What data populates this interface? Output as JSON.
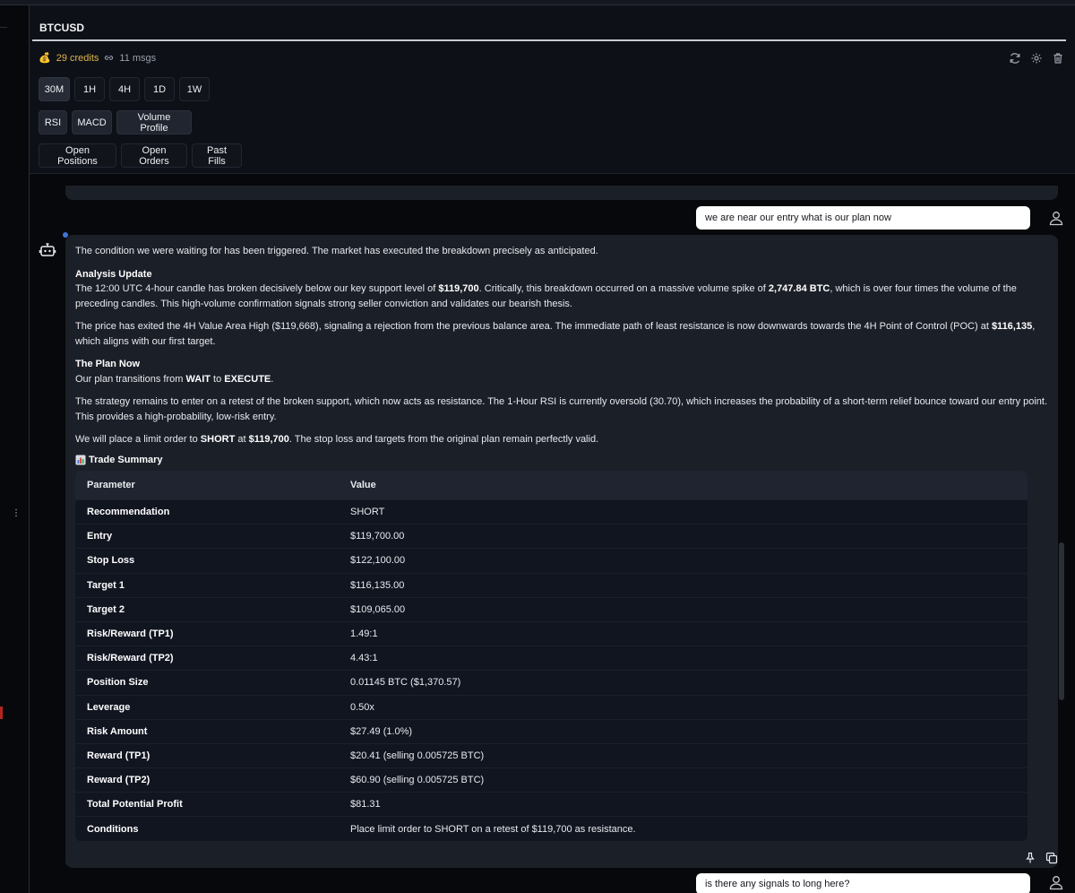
{
  "header": {
    "title": "BTCUSD",
    "credits": "29 credits",
    "msgs": "11 msgs",
    "icons": [
      "refresh-icon",
      "settings-icon",
      "trash-icon"
    ]
  },
  "timeframes": [
    "30M",
    "1H",
    "4H",
    "1D",
    "1W"
  ],
  "active_timeframe": "30M",
  "indicators": [
    "RSI",
    "MACD",
    "Volume Profile"
  ],
  "data_tabs": [
    "Open Positions",
    "Open Orders",
    "Past Fills"
  ],
  "chat": {
    "user_msg_1": "we are near our entry what is our plan now",
    "user_msg_2": "is there any signals to long here?",
    "bot": {
      "intro": "The condition we were waiting for has been triggered. The market has executed the breakdown precisely as anticipated.",
      "analysis_heading": "Analysis Update",
      "analysis_p1_a": "The 12:00 UTC 4-hour candle has broken decisively below our key support level of ",
      "analysis_p1_b": "$119,700",
      "analysis_p1_c": ". Critically, this breakdown occurred on a massive volume spike of ",
      "analysis_p1_d": "2,747.84 BTC",
      "analysis_p1_e": ", which is over four times the volume of the preceding candles. This high-volume confirmation signals strong seller conviction and validates our bearish thesis.",
      "analysis_p2_a": "The price has exited the 4H Value Area High ($119,668), signaling a rejection from the previous balance area. The immediate path of least resistance is now downwards towards the 4H Point of Control (POC) at ",
      "analysis_p2_b": "$116,135",
      "analysis_p2_c": ", which aligns with our first target.",
      "plan_heading": "The Plan Now",
      "plan_p1_a": "Our plan transitions from ",
      "plan_p1_b": "WAIT",
      "plan_p1_c": " to ",
      "plan_p1_d": "EXECUTE",
      "plan_p1_e": ".",
      "plan_p2": "The strategy remains to enter on a retest of the broken support, which now acts as resistance. The 1-Hour RSI is currently oversold (30.70), which increases the probability of a short-term relief bounce toward our entry point. This provides a high-probability, low-risk entry.",
      "plan_p3_a": "We will place a limit order to ",
      "plan_p3_b": "SHORT",
      "plan_p3_c": " at ",
      "plan_p3_d": "$119,700",
      "plan_p3_e": ". The stop loss and targets from the original plan remain perfectly valid.",
      "summary_heading": "Trade Summary",
      "table": {
        "headers": [
          "Parameter",
          "Value"
        ],
        "rows": [
          [
            "Recommendation",
            "SHORT"
          ],
          [
            "Entry",
            "$119,700.00"
          ],
          [
            "Stop Loss",
            "$122,100.00"
          ],
          [
            "Target 1",
            "$116,135.00"
          ],
          [
            "Target 2",
            "$109,065.00"
          ],
          [
            "Risk/Reward (TP1)",
            "1.49:1"
          ],
          [
            "Risk/Reward (TP2)",
            "4.43:1"
          ],
          [
            "Position Size",
            "0.01145 BTC ($1,370.57)"
          ],
          [
            "Leverage",
            "0.50x"
          ],
          [
            "Risk Amount",
            "$27.49 (1.0%)"
          ],
          [
            "Reward (TP1)",
            "$20.41 (selling 0.005725 BTC)"
          ],
          [
            "Reward (TP2)",
            "$60.90 (selling 0.005725 BTC)"
          ],
          [
            "Total Potential Profit",
            "$81.31"
          ],
          [
            "Conditions",
            "Place limit order to SHORT on a retest of $119,700 as resistance."
          ]
        ]
      }
    }
  },
  "colors": {
    "accent_gold": "#e0b54a",
    "bubble_bg": "#1b1f28",
    "dot_blue": "#3f74d9"
  }
}
